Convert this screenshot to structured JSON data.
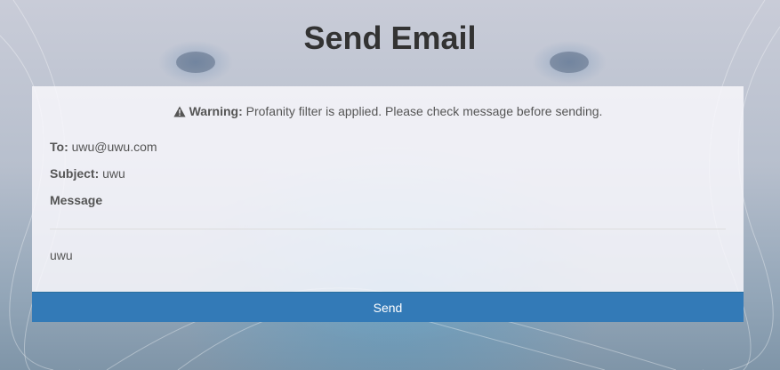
{
  "page": {
    "title": "Send Email"
  },
  "warning": {
    "icon": "warning-triangle-icon",
    "label": "Warning:",
    "text": "Profanity filter is applied. Please check message before sending."
  },
  "email": {
    "to_label": "To:",
    "to_value": "uwu@uwu.com",
    "subject_label": "Subject:",
    "subject_value": "uwu",
    "message_label": "Message",
    "message_value": "uwu"
  },
  "actions": {
    "send_label": "Send"
  },
  "colors": {
    "title": "#333333",
    "text": "#555555",
    "button": "#337ab7",
    "button_text": "#ffffff"
  }
}
